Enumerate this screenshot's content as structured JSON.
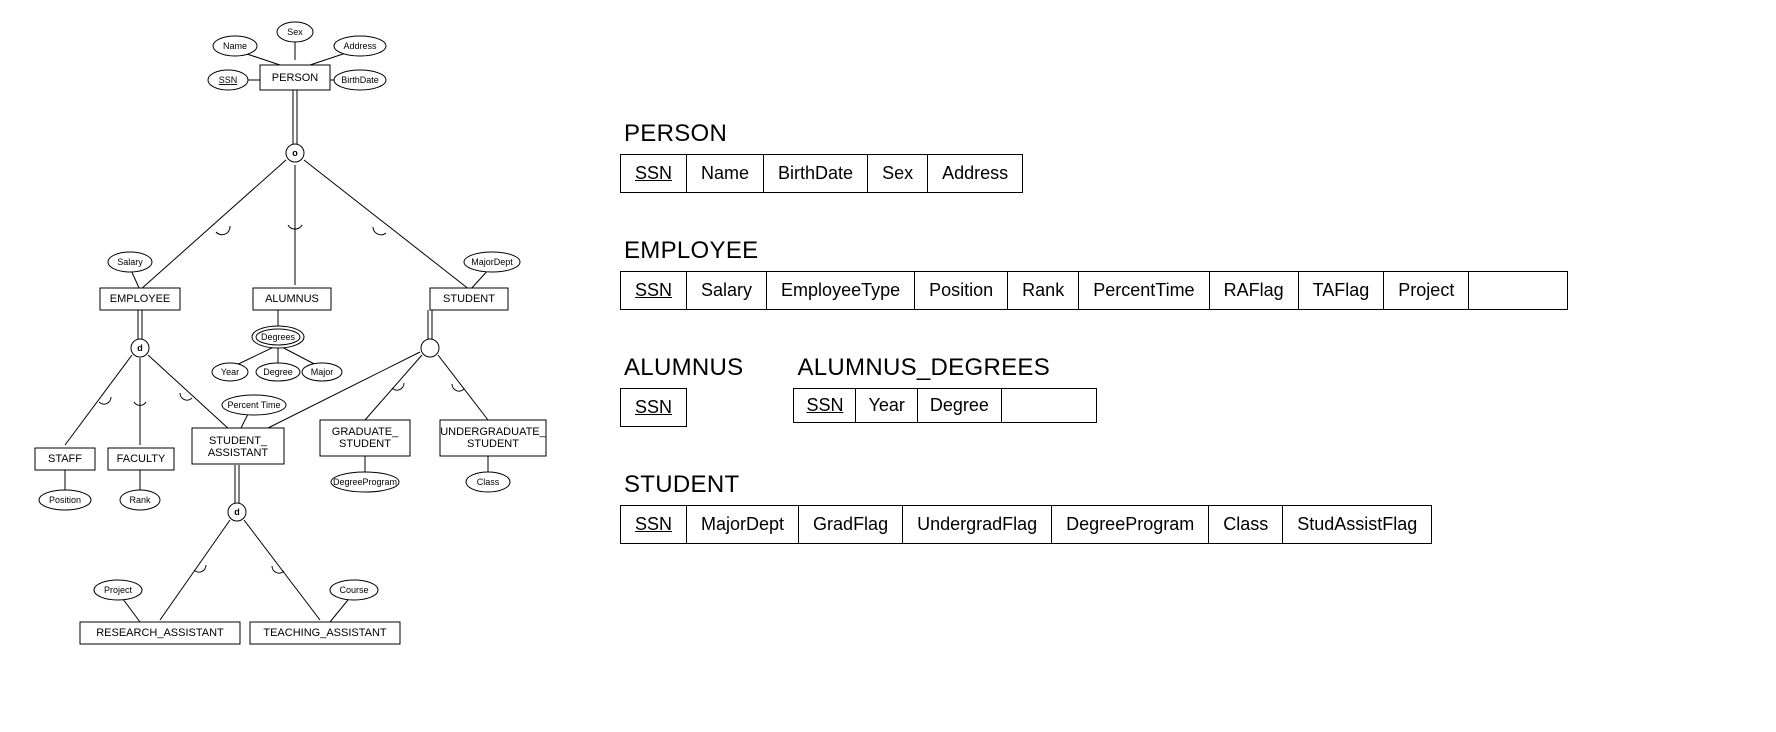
{
  "eer": {
    "entities": {
      "person": "PERSON",
      "employee": "EMPLOYEE",
      "alumnus": "ALUMNUS",
      "student": "STUDENT",
      "staff": "STAFF",
      "faculty": "FACULTY",
      "student_assistant": "STUDENT_\nASSISTANT",
      "graduate_student": "GRADUATE_\nSTUDENT",
      "undergraduate_student": "UNDERGRADUATE_\nSTUDENT",
      "research_assistant": "RESEARCH_ASSISTANT",
      "teaching_assistant": "TEACHING_ASSISTANT"
    },
    "attrs": {
      "name": "Name",
      "sex": "Sex",
      "address": "Address",
      "birthdate": "BirthDate",
      "ssn": "SSN",
      "salary": "Salary",
      "majordept": "MajorDept",
      "degrees": "Degrees",
      "year": "Year",
      "degree": "Degree",
      "major": "Major",
      "percent_time": "Percent Time",
      "position": "Position",
      "rank": "Rank",
      "degreeprogram": "DegreeProgram",
      "class": "Class",
      "project": "Project",
      "course": "Course"
    },
    "spec": {
      "o": "o",
      "d": "d"
    }
  },
  "schemas": {
    "person": {
      "title": "PERSON",
      "cols": [
        "SSN",
        "Name",
        "BirthDate",
        "Sex",
        "Address"
      ],
      "keys": [
        0
      ]
    },
    "employee": {
      "title": "EMPLOYEE",
      "cols": [
        "SSN",
        "Salary",
        "EmployeeType",
        "Position",
        "Rank",
        "PercentTime",
        "RAFlag",
        "TAFlag",
        "Project",
        ""
      ],
      "keys": [
        0
      ]
    },
    "alumnus": {
      "title": "ALUMNUS",
      "cols": [
        "SSN"
      ],
      "keys": [
        0
      ]
    },
    "alumnus_degrees": {
      "title": "ALUMNUS_DEGREES",
      "cols": [
        "SSN",
        "Year",
        "Degree",
        ""
      ],
      "keys": [
        0
      ]
    },
    "student": {
      "title": "STUDENT",
      "cols": [
        "SSN",
        "MajorDept",
        "GradFlag",
        "UndergradFlag",
        "DegreeProgram",
        "Class",
        "StudAssistFlag"
      ],
      "keys": [
        0
      ]
    }
  }
}
